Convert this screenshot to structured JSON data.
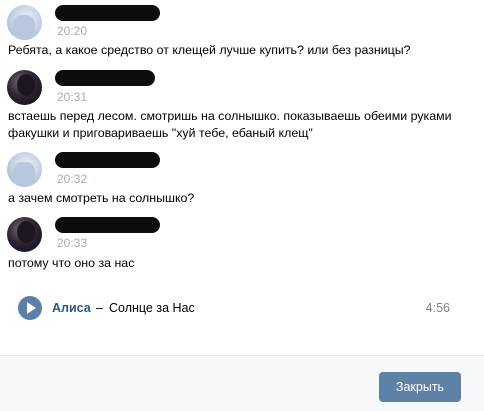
{
  "messages": [
    {
      "avatar": "user-avatar-light",
      "time": "20:20",
      "text": "Ребята, а какое средство от клещей лучше купить? или без разницы?"
    },
    {
      "avatar": "user-avatar-dark",
      "time": "20:31",
      "text": "встаешь перед лесом. смотришь на солнышко. показываешь обеими руками факушки и приговариваешь \"хуй тебе, ебаный клещ\""
    },
    {
      "avatar": "user-avatar-light",
      "time": "20:32",
      "text": "а зачем смотреть на солнышко?"
    },
    {
      "avatar": "user-avatar-dark",
      "time": "20:33",
      "text": "потому что оно за нас"
    }
  ],
  "audio": {
    "artist": "Алиса",
    "separator": "–",
    "title": "Солнце за Нас",
    "duration": "4:56",
    "icon": "play-icon"
  },
  "footer": {
    "close_label": "Закрыть"
  },
  "colors": {
    "accent": "#5e81a8",
    "link": "#2a5885",
    "timestamp": "#a8acb3"
  }
}
